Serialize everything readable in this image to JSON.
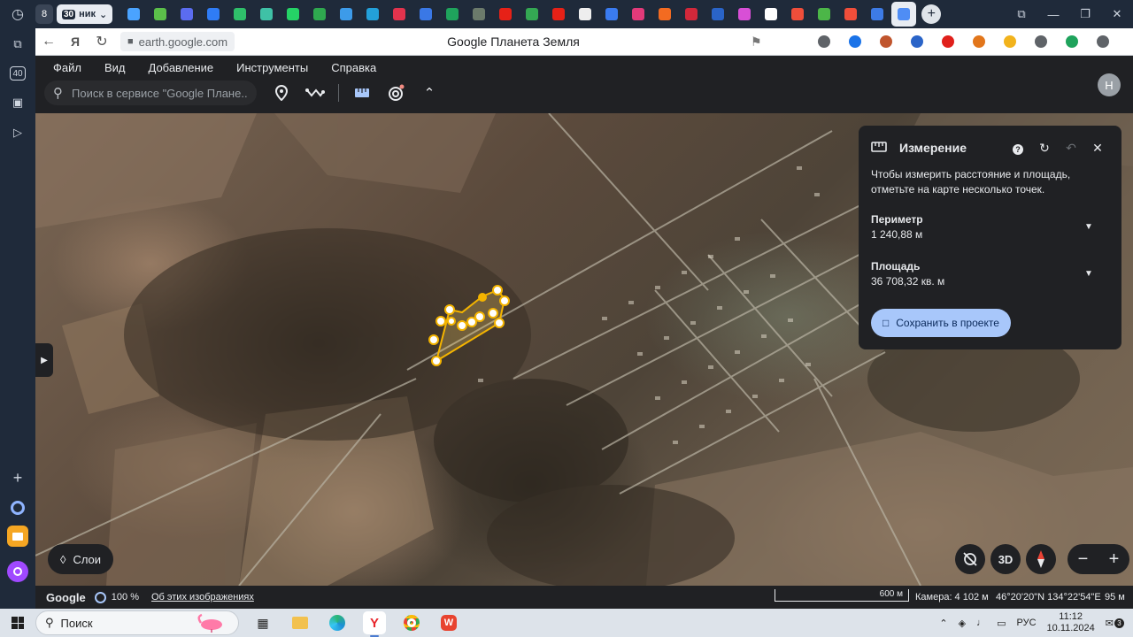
{
  "browser": {
    "tab_counter": "8",
    "active_tab_count": "30",
    "active_tab_label": "ник",
    "url": "earth.google.com",
    "page_title": "Google Планета Земля",
    "tab_favicons": [
      {
        "name": "yandex-home-favicon",
        "color": "#4aa3ff"
      },
      {
        "name": "plant-favicon",
        "color": "#5bbf4a"
      },
      {
        "name": "chat-favicon",
        "color": "#5b6cf0"
      },
      {
        "name": "atlassian-favicon",
        "color": "#2f7cf6"
      },
      {
        "name": "green-app-favicon",
        "color": "#2fbf6a"
      },
      {
        "name": "teams-favicon",
        "color": "#3fc1a6"
      },
      {
        "name": "whatsapp-favicon",
        "color": "#25d366"
      },
      {
        "name": "check-favicon",
        "color": "#2fa84f"
      },
      {
        "name": "grid-favicon",
        "color": "#3d9be9"
      },
      {
        "name": "diamond-favicon",
        "color": "#23a0d9"
      },
      {
        "name": "heart-favicon",
        "color": "#e2334d"
      },
      {
        "name": "mail-favicon",
        "color": "#3a78e6"
      },
      {
        "name": "plus-favicon",
        "color": "#1fa35c"
      },
      {
        "name": "leaf-favicon",
        "color": "#6b7a6b"
      },
      {
        "name": "youtube-favicon",
        "color": "#e62117"
      },
      {
        "name": "maps-favicon",
        "color": "#34a853"
      },
      {
        "name": "youtube-favicon-2",
        "color": "#e62117"
      },
      {
        "name": "disc-favicon",
        "color": "#eeeeee"
      },
      {
        "name": "messenger-favicon",
        "color": "#3a7bf0"
      },
      {
        "name": "pink-favicon",
        "color": "#e23a7a"
      },
      {
        "name": "f-favicon",
        "color": "#f36b21"
      },
      {
        "name": "red-badge-favicon",
        "color": "#d2283a"
      },
      {
        "name": "blue-gear-favicon",
        "color": "#2a64c8"
      },
      {
        "name": "circle-pink-favicon",
        "color": "#d84fd6"
      },
      {
        "name": "y-favicon",
        "color": "#ffffff"
      },
      {
        "name": "ya-favicon",
        "color": "#f04e3a"
      },
      {
        "name": "hd-favicon",
        "color": "#4cb648"
      },
      {
        "name": "ya-favicon-2",
        "color": "#f04e3a"
      },
      {
        "name": "blue-ball-favicon",
        "color": "#3d7be6"
      },
      {
        "name": "google-earth-favicon",
        "color": "#4f8df5"
      }
    ],
    "extensions": [
      {
        "name": "lightbulb-extension",
        "color": "#5f6368"
      },
      {
        "name": "download-extension",
        "color": "#1a73e8"
      },
      {
        "name": "pie-extension",
        "color": "#c0552d"
      },
      {
        "name": "globe-extension",
        "color": "#2a64c8"
      },
      {
        "name": "record-extension",
        "color": "#e0201b"
      },
      {
        "name": "fox-extension",
        "color": "#e2761b"
      },
      {
        "name": "battery-extension",
        "color": "#f2b31c"
      },
      {
        "name": "puzzle-extension",
        "color": "#5f6368"
      },
      {
        "name": "shield-extension",
        "color": "#1fa35c"
      },
      {
        "name": "profile-extension",
        "color": "#5f6368"
      }
    ]
  },
  "sidebar": {
    "badge_40": "40"
  },
  "earth": {
    "menu": [
      "Файл",
      "Вид",
      "Добавление",
      "Инструменты",
      "Справка"
    ],
    "search_placeholder": "Поиск в сервисе \"Google Плане...",
    "avatar_letter": "Н",
    "layers_label": "Слои",
    "button_3d": "3D",
    "measure": {
      "title": "Измерение",
      "hint": "Чтобы измерить расстояние и площадь, отметьте на карте несколько точек.",
      "perimeter_label": "Периметр",
      "perimeter_value": "1 240,88 м",
      "area_label": "Площадь",
      "area_value": "36 708,32 кв. м",
      "save_label": "Сохранить в проекте"
    },
    "status": {
      "logo": "Google",
      "percent": "100 %",
      "about_link": "Об этих изображениях",
      "scale": "600 м",
      "camera": "Камера: 4 102 м",
      "coordinates": "46°20'20\"N 134°22'54\"E",
      "altitude": "95 м"
    }
  },
  "taskbar": {
    "search_label": "Поиск",
    "language": "РУС",
    "time": "11:12",
    "date": "10.11.2024",
    "notification_count": "3"
  }
}
